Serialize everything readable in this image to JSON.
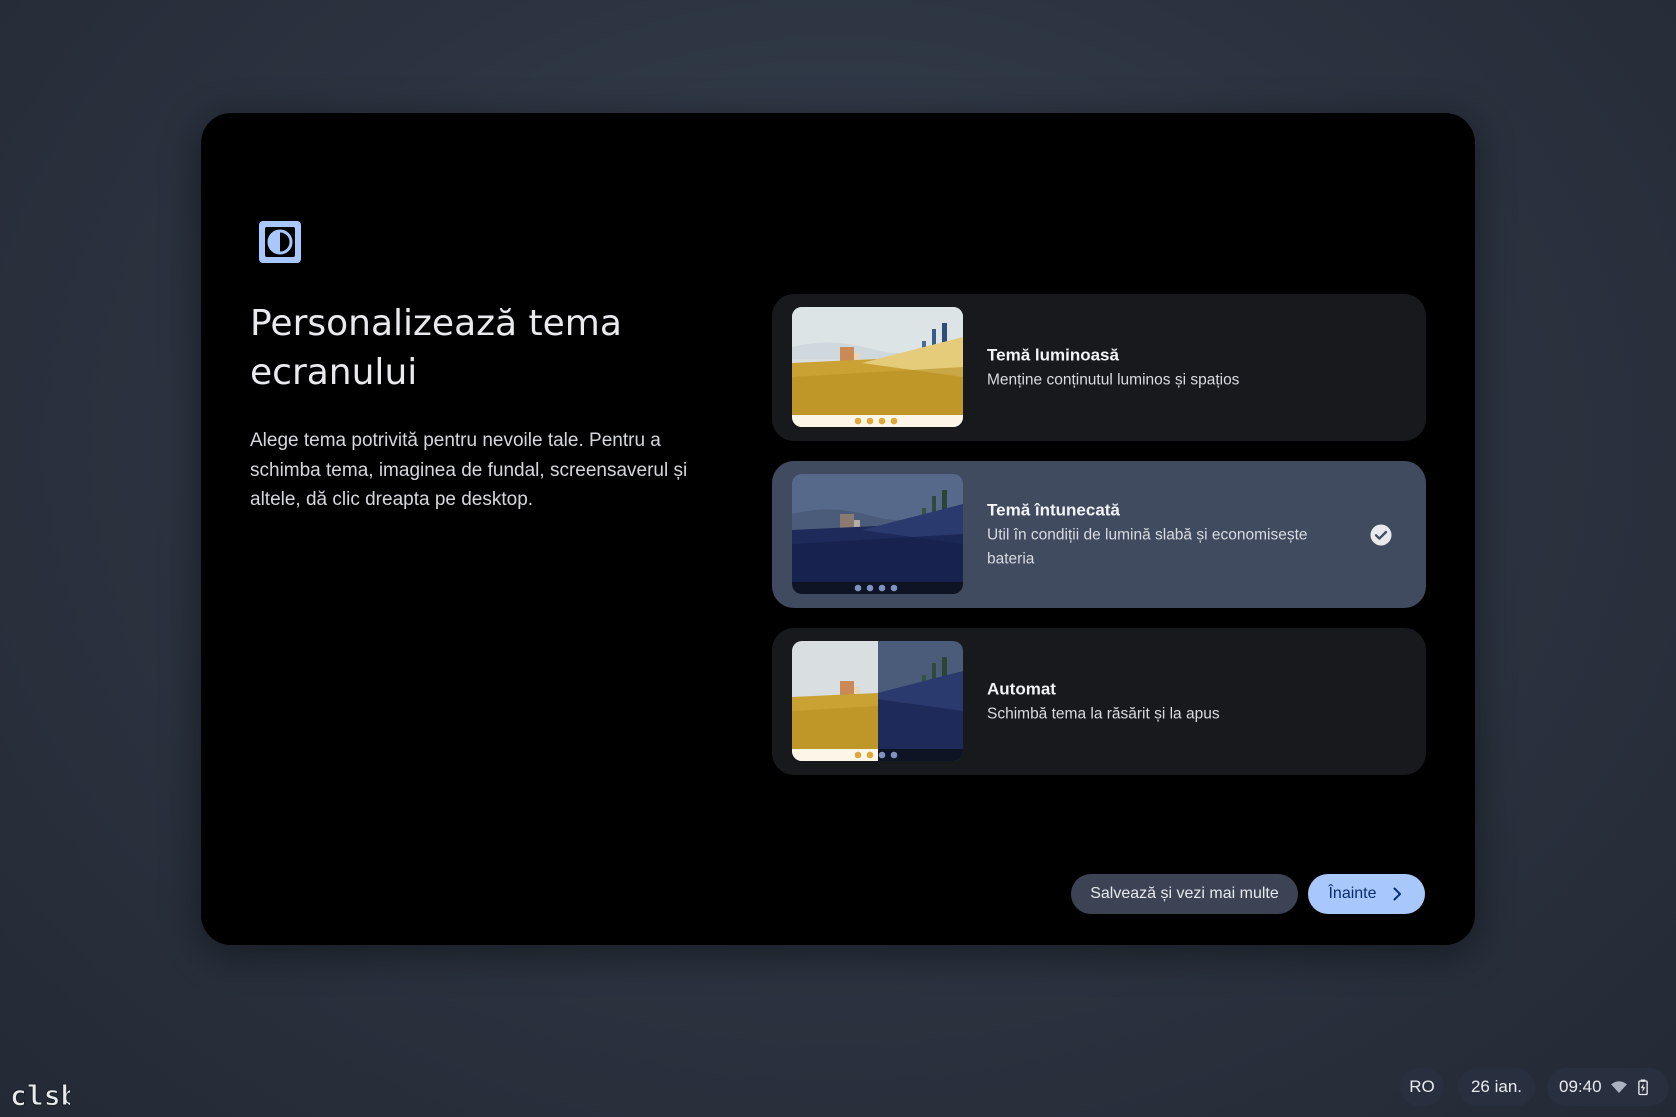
{
  "dialog": {
    "title": "Personalizează tema ecranului",
    "description": "Alege tema potrivită pentru nevoile tale. Pentru a schimba tema, imaginea de fundal, screensaverul și altele, dă clic dreapta pe desktop.",
    "options": [
      {
        "title": "Temă luminoasă",
        "subtitle": "Menține conținutul luminos și spațios",
        "selected": false
      },
      {
        "title": "Temă întunecată",
        "subtitle": "Util în condiții de lumină slabă și economisește bateria",
        "selected": true
      },
      {
        "title": "Automat",
        "subtitle": "Schimbă tema la răsărit și la apus",
        "selected": false
      }
    ],
    "buttons": {
      "secondary": "Salvează și vezi mai multe",
      "primary": "Înainte"
    }
  },
  "shelf": {
    "language": "RO",
    "date": "26 ian.",
    "time": "09:40"
  },
  "watermark": "clsb",
  "colors": {
    "accent": "#a8c7fa",
    "selected_card": "#414b60",
    "card": "#17191d"
  },
  "icons": [
    "theme-contrast-icon",
    "check-circle-icon",
    "chevron-right-icon",
    "wifi-icon",
    "battery-icon"
  ]
}
